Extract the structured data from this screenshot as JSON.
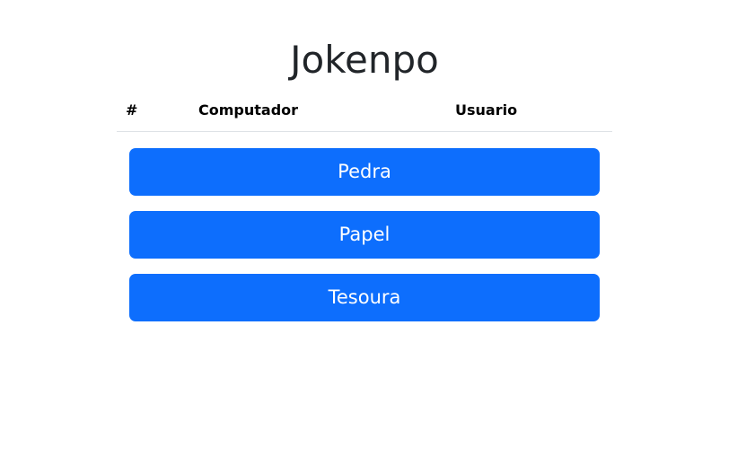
{
  "title": "Jokenpo",
  "table": {
    "headers": {
      "number": "#",
      "computer": "Computador",
      "user": "Usuario"
    }
  },
  "moves": [
    {
      "label": "Pedra"
    },
    {
      "label": "Papel"
    },
    {
      "label": "Tesoura"
    }
  ],
  "colors": {
    "button_bg": "#0d6efd",
    "button_text": "#ffffff",
    "title_text": "#212529",
    "table_border": "#dee2e6"
  }
}
